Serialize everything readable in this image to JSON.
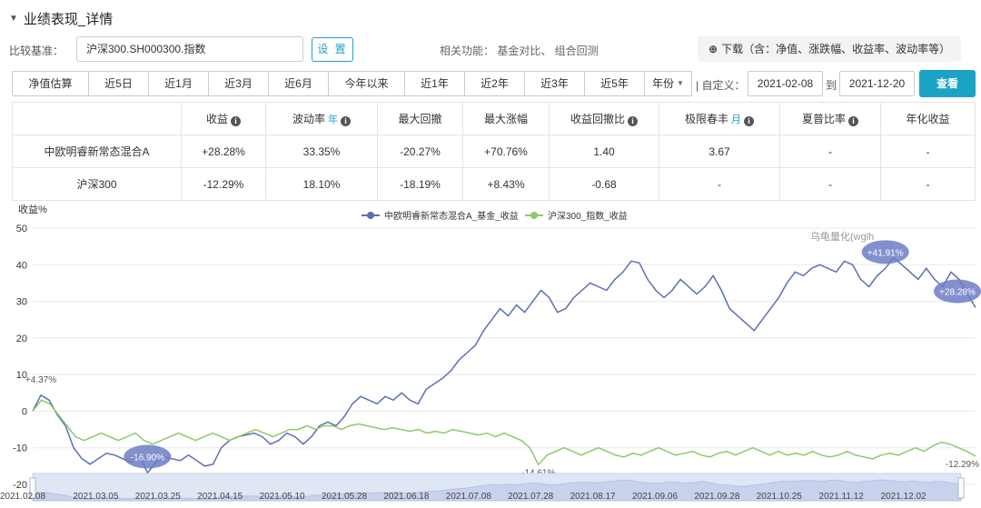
{
  "header": {
    "title": "业绩表现_详情",
    "chevron_icon": "chevron-down-icon"
  },
  "benchmark": {
    "label": "比较基准：",
    "value": "沪深300.SH000300.指数",
    "set_button": "设 置",
    "related": "相关功能： 基金对比、 组合回测",
    "download": "下载（含：净值、涨跌幅、收益率、波动率等）",
    "download_icon": "download-icon"
  },
  "range": {
    "buttons": [
      "净值估算",
      "近5日",
      "近1月",
      "近3月",
      "近6月",
      "今年以来",
      "近1年",
      "近2年",
      "近3年",
      "近5年"
    ],
    "year_button": "年份",
    "custom_label": "| 自定义：",
    "start_date": "2021-02-08",
    "to_label": "到",
    "end_date": "2021-12-20",
    "query_button": "查看"
  },
  "table": {
    "headers": [
      "",
      "收益",
      "波动率",
      "最大回撤",
      "最大涨幅",
      "收益回撤比",
      "极限春丰",
      "夏普比率",
      "年化收益"
    ],
    "header_units": {
      "2": "年",
      "6": "月"
    },
    "header_info": [
      1,
      2,
      5,
      6,
      7
    ],
    "rows": [
      {
        "name": "中欧明睿新常态混合A",
        "cells": [
          "+28.28%",
          "33.35%",
          "-20.27%",
          "+70.76%",
          "1.40",
          "3.67",
          "-",
          "-"
        ]
      },
      {
        "name": "沪深300",
        "cells": [
          "-12.29%",
          "18.10%",
          "-18.19%",
          "+8.43%",
          "-0.68",
          "-",
          "-",
          "-"
        ]
      }
    ]
  },
  "chart_data": {
    "type": "line",
    "ylabel": "收益%",
    "ylim": [
      -20,
      50
    ],
    "yticks": [
      50,
      40,
      30,
      20,
      10,
      0,
      -10,
      -20
    ],
    "grid": true,
    "legend_position": "top-center",
    "watermark": "乌龟量化(wglh",
    "xticks": [
      "2021.02.08",
      "2021.03.05",
      "2021.03.25",
      "2021.04.15",
      "2021.05.10",
      "2021.05.28",
      "2021.06.18",
      "2021.07.08",
      "2021.07.28",
      "2021.08.17",
      "2021.09.06",
      "2021.09.28",
      "2021.10.25",
      "2021.11.12",
      "2021.12.02"
    ],
    "series": [
      {
        "name": "中欧明睿新常态混合A_基金_收益",
        "color": "#5b6fb5",
        "values": [
          0,
          4.37,
          3,
          -1,
          -4,
          -10,
          -13,
          -14.5,
          -13,
          -11.5,
          -12,
          -13,
          -14,
          -12,
          -16.9,
          -14,
          -12.5,
          -13,
          -13.5,
          -12,
          -13.5,
          -15,
          -14.5,
          -10,
          -8,
          -7,
          -6.5,
          -6,
          -7,
          -9,
          -8,
          -6,
          -7,
          -9,
          -7,
          -4,
          -3,
          -4,
          -1.5,
          2,
          4,
          3,
          2,
          4,
          3,
          5,
          3,
          2,
          6,
          7.5,
          9,
          11,
          14,
          16,
          18,
          22,
          25,
          28,
          26,
          29,
          27,
          30,
          33,
          31,
          27,
          28,
          31,
          33,
          35,
          34,
          33,
          36,
          38,
          41,
          40.5,
          36,
          33,
          31,
          33,
          36,
          34,
          32,
          34,
          37,
          33,
          28,
          26,
          24,
          22,
          25,
          28,
          31,
          35,
          38,
          37,
          39,
          40,
          39,
          38,
          41,
          40,
          36,
          34,
          37,
          39,
          41.91,
          40,
          38,
          36,
          39,
          36,
          34,
          38,
          36,
          32,
          28.28
        ],
        "labels": [
          {
            "i": 1,
            "text": "+4.37%"
          },
          {
            "i": 14,
            "text": "-16.90%"
          },
          {
            "i": 104,
            "text": "+41.91%"
          },
          {
            "i": 115,
            "text": "+28.28%"
          }
        ]
      },
      {
        "name": "沪深300_指数_收益",
        "color": "#8dc96a",
        "values": [
          0,
          3,
          2,
          -1,
          -4,
          -7,
          -8,
          -7,
          -6,
          -7,
          -8,
          -7,
          -6,
          -8,
          -9,
          -8,
          -7,
          -6,
          -7,
          -8,
          -7,
          -6,
          -7,
          -8,
          -7,
          -6,
          -5,
          -6,
          -7,
          -6,
          -5,
          -5,
          -4,
          -5,
          -4,
          -4,
          -5,
          -4,
          -3.5,
          -4,
          -4.5,
          -5,
          -4.5,
          -5,
          -5.5,
          -5,
          -6,
          -5.5,
          -6,
          -5,
          -5.5,
          -6,
          -6.5,
          -6,
          -7,
          -6,
          -7,
          -8,
          -10,
          -14.61,
          -12,
          -11,
          -10,
          -11,
          -12,
          -11,
          -10,
          -11,
          -12,
          -12.5,
          -11.5,
          -12,
          -11,
          -10,
          -11,
          -12,
          -11.5,
          -11,
          -12,
          -12.5,
          -11.5,
          -11,
          -12,
          -11,
          -10,
          -11,
          -12,
          -11,
          -12,
          -11.5,
          -12,
          -11,
          -12,
          -12.5,
          -12,
          -11,
          -12,
          -12.5,
          -13,
          -12,
          -11.5,
          -12,
          -11,
          -10,
          -11,
          -9.5,
          -8.5,
          -9,
          -10,
          -11,
          -12.29
        ],
        "labels": [
          {
            "i": 59,
            "text": "-14.61%"
          },
          {
            "i": 110,
            "text": "-12.29%"
          }
        ]
      }
    ]
  }
}
